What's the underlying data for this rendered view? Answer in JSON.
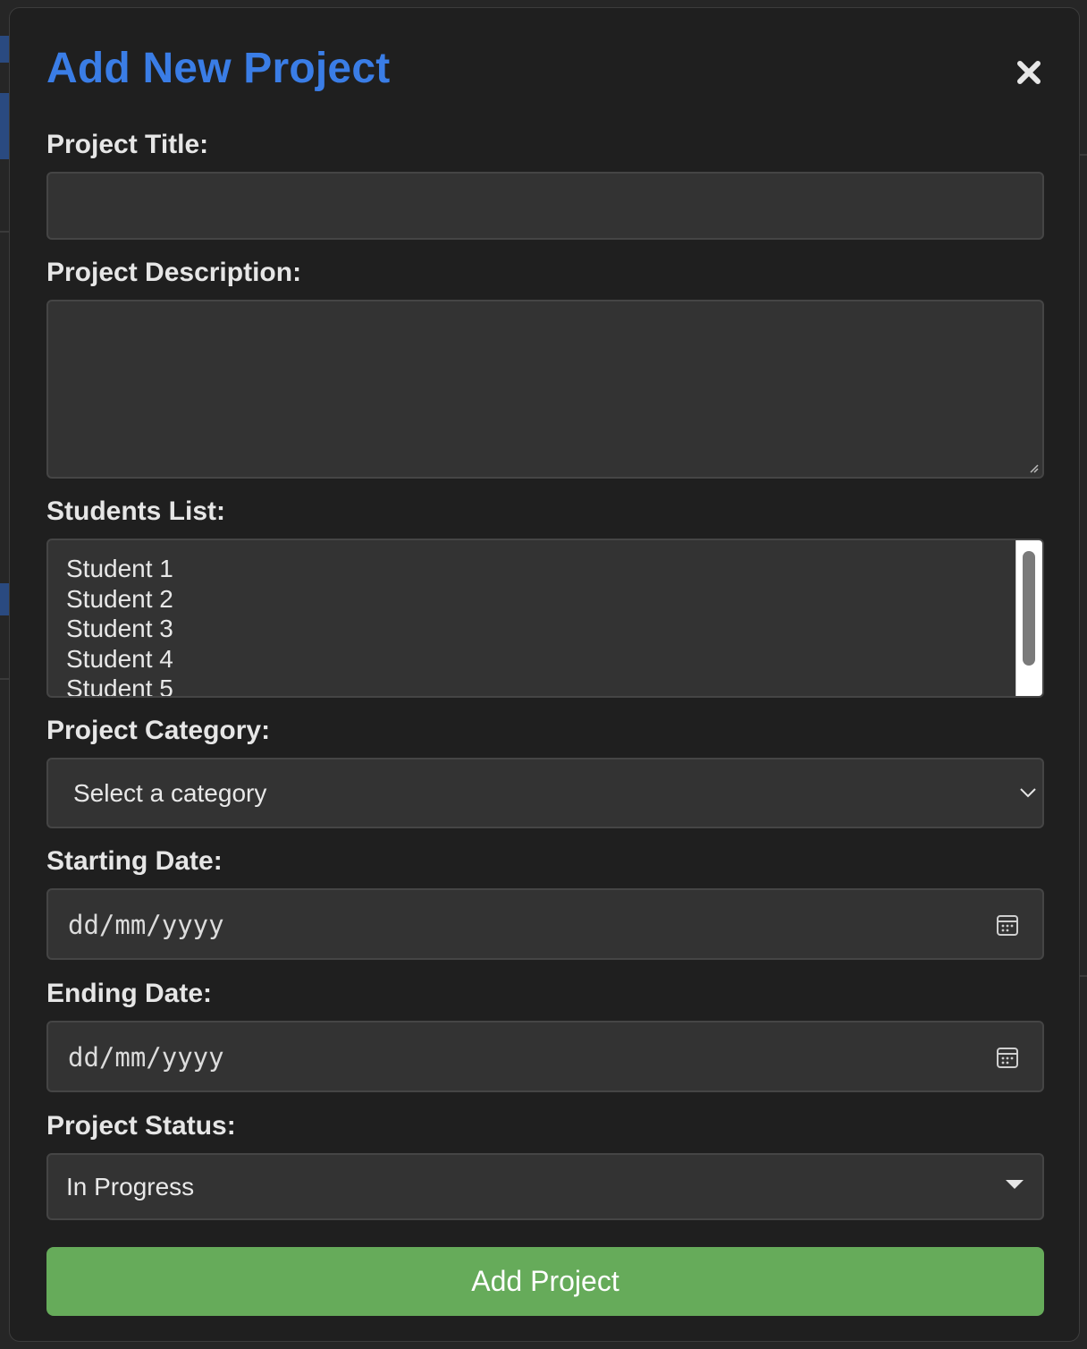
{
  "modal": {
    "title": "Add New Project",
    "close_icon": "close-icon"
  },
  "form": {
    "title_label": "Project Title:",
    "title_value": "",
    "description_label": "Project Description:",
    "description_value": "",
    "students_label": "Students List:",
    "students": [
      "Student 1",
      "Student 2",
      "Student 3",
      "Student 4",
      "Student 5"
    ],
    "category_label": "Project Category:",
    "category_value": "Select a category",
    "start_label": "Starting Date:",
    "start_placeholder": "dd/mm/yyyy",
    "end_label": "Ending Date:",
    "end_placeholder": "dd/mm/yyyy",
    "status_label": "Project Status:",
    "status_value": "In Progress",
    "submit_label": "Add Project"
  },
  "colors": {
    "title": "#3a7de6",
    "submit": "#66ab5a",
    "modal_bg": "#1f1f1f",
    "input_bg": "#333333"
  }
}
